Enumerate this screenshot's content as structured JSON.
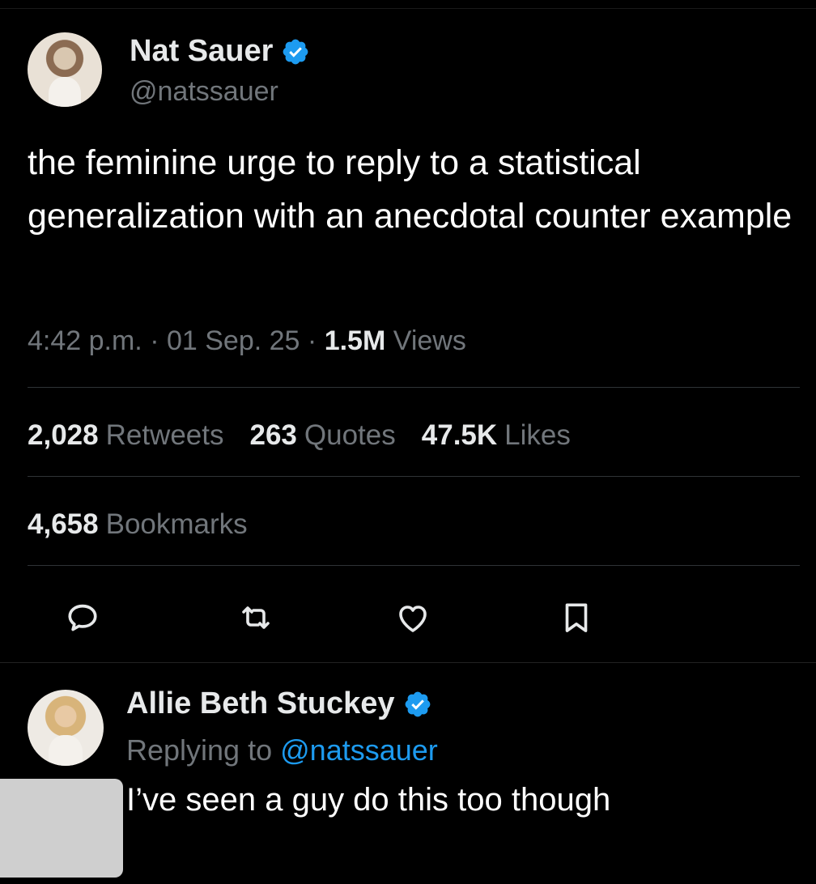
{
  "tweet": {
    "author_name": "Nat Sauer",
    "author_handle": "@natssauer",
    "text": "the feminine urge to reply to a statistical generalization with an anecdotal counter example",
    "time": "4:42 p.m.",
    "date": "01 Sep. 25",
    "views_count": "1.5M",
    "views_label": "Views",
    "separator": "·",
    "retweets_count": "2,028",
    "retweets_label": "Retweets",
    "quotes_count": "263",
    "quotes_label": "Quotes",
    "likes_count": "47.5K",
    "likes_label": "Likes",
    "bookmarks_count": "4,658",
    "bookmarks_label": "Bookmarks"
  },
  "actions": [
    "reply-icon",
    "retweet-icon",
    "like-icon",
    "bookmark-icon"
  ],
  "reply": {
    "author_name": "Allie Beth Stuckey",
    "replying_prefix": "Replying to",
    "replying_handle": "@natssauer",
    "text": "I’ve seen a guy do this too though"
  },
  "colors": {
    "background": "#000000",
    "primary_text": "#e7e9ea",
    "secondary_text": "#71767b",
    "accent": "#1d9bf0",
    "divider": "#2f3336"
  }
}
